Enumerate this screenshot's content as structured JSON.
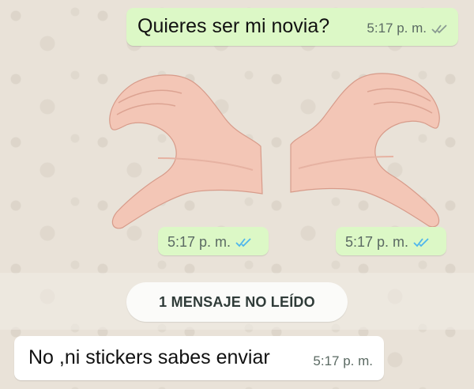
{
  "chat": {
    "messages": [
      {
        "direction": "outgoing",
        "text": "Quieres ser mi novia?",
        "time": "5:17 p. m.",
        "status": "read-gray-ticks"
      },
      {
        "direction": "outgoing",
        "type": "sticker",
        "sticker": "left-hand-half-heart",
        "time": "5:17 p. m.",
        "status": "read-blue-ticks"
      },
      {
        "direction": "outgoing",
        "type": "sticker",
        "sticker": "right-hand-half-heart",
        "time": "5:17 p. m.",
        "status": "read-blue-ticks"
      },
      {
        "direction": "incoming",
        "text": "No ,ni stickers sabes enviar",
        "time": "5:17 p. m."
      }
    ],
    "unread_banner": "1 MENSAJE NO LEÍDO"
  },
  "colors": {
    "outgoing_bubble": "#dcf8c6",
    "incoming_bubble": "#ffffff",
    "read_ticks": "#4fb6ec",
    "sent_ticks": "#8a9a92",
    "wallpaper": "#e9e2d8"
  }
}
